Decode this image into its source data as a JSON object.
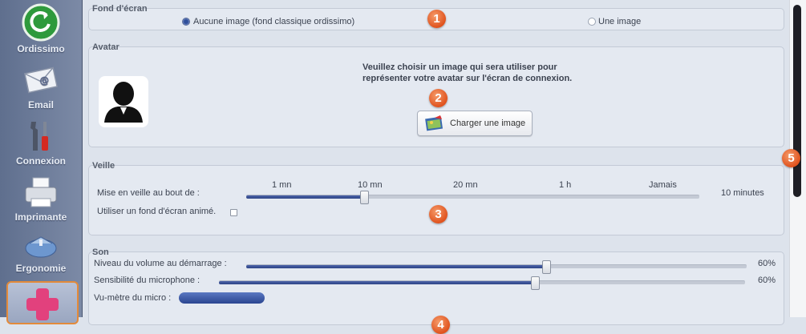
{
  "sidebar": {
    "items": [
      {
        "label": "Ordissimo",
        "icon": "ordissimo-logo-icon"
      },
      {
        "label": "Email",
        "icon": "envelope-icon"
      },
      {
        "label": "Connexion",
        "icon": "tools-icon"
      },
      {
        "label": "Imprimante",
        "icon": "printer-icon"
      },
      {
        "label": "Ergonomie",
        "icon": "mouse-icon"
      },
      {
        "label": "",
        "icon": "plus-icon"
      }
    ]
  },
  "wallpaper": {
    "title": "Fond d'écran",
    "option_none": "Aucune image (fond classique ordissimo)",
    "option_image": "Une image",
    "selected": "option_none"
  },
  "avatar": {
    "title": "Avatar",
    "message_line1": "Veuillez choisir un image qui sera utiliser pour",
    "message_line2": "représenter votre avatar sur l'écran de connexion.",
    "button_label": "Charger une image",
    "icon": "user-silhouette-icon"
  },
  "sleep": {
    "title": "Veille",
    "label": "Mise en veille au bout de :",
    "ticks": [
      "1 mn",
      "10 mn",
      "20 mn",
      "1 h",
      "Jamais"
    ],
    "current_value": "10 minutes",
    "position_fraction": 0.26,
    "animated_label": "Utiliser un fond d'écran animé.",
    "animated_checked": false
  },
  "sound": {
    "title": "Son",
    "volume_label": "Niveau du volume au démarrage :",
    "volume_value": "60%",
    "volume_fraction": 0.6,
    "mic_label": "Sensibilité du microphone :",
    "mic_value": "60%",
    "mic_fraction": 0.6,
    "meter_label": "Vu-mètre du micro :"
  },
  "badges": [
    "1",
    "2",
    "3",
    "4",
    "5"
  ],
  "colors": {
    "accent_blue": "#2d4487",
    "badge_orange": "#e0531e",
    "active_outline": "#e38a3a"
  }
}
